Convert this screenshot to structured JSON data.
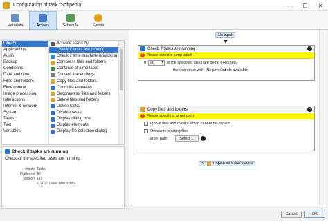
{
  "window": {
    "title": "Configuration of task \"Softpedia\"",
    "minimize": "—",
    "maximize": "☐",
    "close": "✕"
  },
  "toolbar": [
    {
      "label": "Metadata",
      "icon": "metadata-icon",
      "color": "#6b8fb8"
    },
    {
      "label": "Actions",
      "icon": "actions-icon",
      "color": "#4a7cc4"
    },
    {
      "label": "Schedule",
      "icon": "schedule-icon",
      "color": "#5a9a5a"
    },
    {
      "label": "Events",
      "icon": "events-icon",
      "color": "#e8a21a"
    }
  ],
  "categories": [
    "Library",
    "Applications",
    "Audio",
    "Backup",
    "Conditions",
    "Date and time",
    "Files and folders",
    "Flow control",
    "Image processing",
    "Interactions",
    "Internet & network",
    "System",
    "Tasks",
    "Text",
    "Variables"
  ],
  "selected_category": "Library",
  "actions": [
    {
      "label": "Activate stand by",
      "color": "#555555"
    },
    {
      "label": "Check if tasks are running",
      "color": "#1e6fd6"
    },
    {
      "label": "Check if time machine is backing up data",
      "color": "#2e8bd1"
    },
    {
      "label": "Compress files and folders",
      "color": "#d8a43a"
    },
    {
      "label": "Continue at jump label",
      "color": "#3a8a3a"
    },
    {
      "label": "Convert line endings",
      "color": "#7a7a7a"
    },
    {
      "label": "Copy files and folders",
      "color": "#d8a43a"
    },
    {
      "label": "Count list elements",
      "color": "#2e6fd1"
    },
    {
      "label": "Decompress files and folders",
      "color": "#d8a43a"
    },
    {
      "label": "Delete files and folders",
      "color": "#d8a43a"
    },
    {
      "label": "Delete tasks",
      "color": "#1e6fd6"
    },
    {
      "label": "Disable tasks",
      "color": "#1e6fd6"
    },
    {
      "label": "Display dialog box",
      "color": "#3a6fc4"
    },
    {
      "label": "Display elements",
      "color": "#3a6fc4"
    },
    {
      "label": "Display file selection dialog",
      "color": "#3a6fc4"
    }
  ],
  "description": {
    "title": "Check if tasks are running",
    "text": "Checks if the specified tasks are running."
  },
  "meta": [
    {
      "key": "Inputs",
      "value": "Tasks"
    },
    {
      "key": "Platforms",
      "value": "All"
    },
    {
      "key": "Version",
      "value": "1.0"
    },
    {
      "key": "",
      "value": "© 2017 Oliver Matuschin"
    }
  ],
  "workflow": {
    "no_input": "No input",
    "block1": {
      "title": "Check if tasks are running",
      "warning": "Please select a jump label!",
      "if_label": "If",
      "if_value": "all",
      "if_rest": "of the specified tasks are being executed,",
      "then_text": "then continue with",
      "then_value": "No jump labels available"
    },
    "block2": {
      "title": "Copy files and folders",
      "warning": "Please specify a target path!",
      "opt1": "Ignore files and folders which cannot be copied",
      "opt2": "Overwrite existing files",
      "target_label": "Target path:",
      "select_button": "Select ...",
      "output": "Copied files and folders"
    }
  },
  "buttons": {
    "cancel": "Cancel",
    "ok": "OK"
  }
}
